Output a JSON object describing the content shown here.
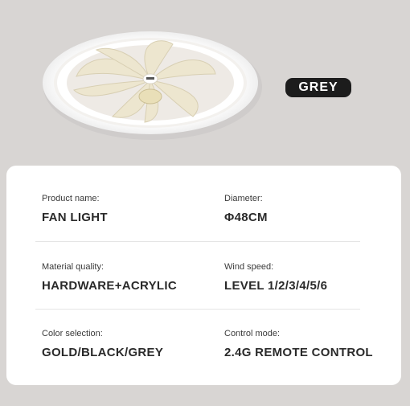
{
  "badge": {
    "label": "GREY"
  },
  "colors": {
    "background": "#d8d5d3",
    "badge": "#1c1c1c",
    "card": "#ffffff"
  },
  "product_image": {
    "icon": "ceiling-fan-light-image"
  },
  "specs": [
    {
      "label": "Product name:",
      "value": "FAN LIGHT"
    },
    {
      "label": "Diameter:",
      "value": "Φ48CM"
    },
    {
      "label": "Material quality:",
      "value": "HARDWARE+ACRYLIC"
    },
    {
      "label": "Wind speed:",
      "value": "LEVEL 1/2/3/4/5/6"
    },
    {
      "label": "Color selection:",
      "value": "GOLD/BLACK/GREY"
    },
    {
      "label": "Control mode:",
      "value": "2.4G REMOTE CONTROL"
    }
  ]
}
